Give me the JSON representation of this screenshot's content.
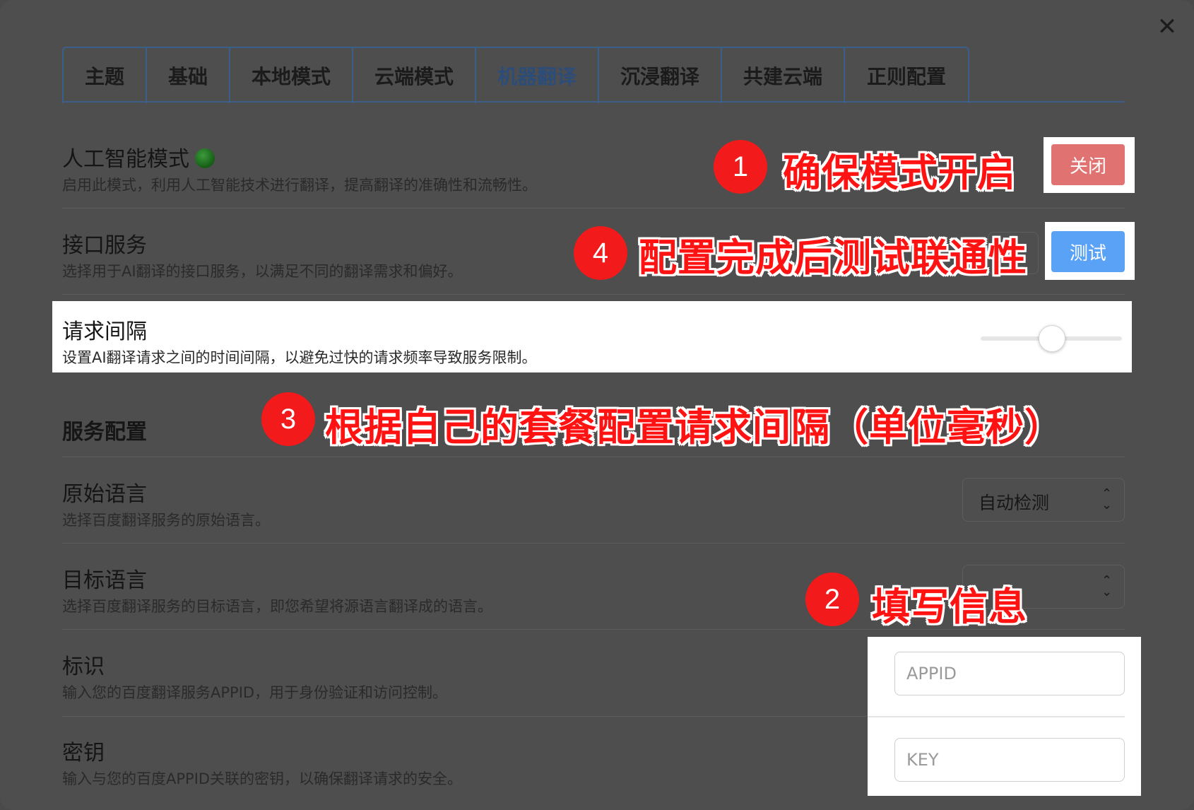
{
  "dialog": {
    "close_label": "✕"
  },
  "tabs": [
    {
      "label": "主题",
      "active": false
    },
    {
      "label": "基础",
      "active": false
    },
    {
      "label": "本地模式",
      "active": false
    },
    {
      "label": "云端模式",
      "active": false
    },
    {
      "label": "机器翻译",
      "active": true
    },
    {
      "label": "沉浸翻译",
      "active": false
    },
    {
      "label": "共建云端",
      "active": false
    },
    {
      "label": "正则配置",
      "active": false
    }
  ],
  "ai_mode": {
    "title": "人工智能模式",
    "description": "启用此模式，利用人工智能技术进行翻译，提高翻译的准确性和流畅性。",
    "status_color": "#1f7a1f",
    "button_label": "关闭",
    "button_color": "#e07272"
  },
  "api_service": {
    "title": "接口服务",
    "description": "选择用于AI翻译的接口服务，以满足不同的翻译需求和偏好。",
    "button_label": "测试",
    "button_color": "#5aa2f6"
  },
  "request_interval": {
    "title": "请求间隔",
    "description": "设置AI翻译请求之间的时间间隔，以避免过快的请求频率导致服务限制。",
    "slider_fraction": 0.5
  },
  "service_config": {
    "section_title": "服务配置"
  },
  "source_language": {
    "title": "原始语言",
    "description": "选择百度翻译服务的原始语言。",
    "selected": "自动检测"
  },
  "target_language": {
    "title": "目标语言",
    "description": "选择百度翻译服务的目标语言，即您希望将源语言翻译成的语言。"
  },
  "app_id": {
    "title": "标识",
    "description": "输入您的百度翻译服务APPID，用于身份验证和访问控制。",
    "placeholder": "APPID"
  },
  "secret_key": {
    "title": "密钥",
    "description": "输入与您的百度APPID关联的密钥，以确保翻译请求的安全。",
    "placeholder": "KEY"
  },
  "annotations": [
    {
      "number": "1",
      "text": "确保模式开启"
    },
    {
      "number": "2",
      "text": "填写信息"
    },
    {
      "number": "3",
      "text": "根据自己的套餐配置请求间隔（单位毫秒）"
    },
    {
      "number": "4",
      "text": "配置完成后测试联通性"
    }
  ]
}
